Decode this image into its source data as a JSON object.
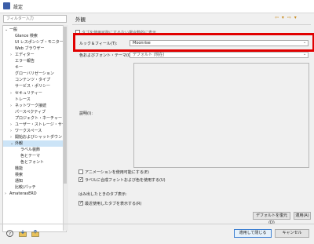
{
  "window": {
    "title": "設定"
  },
  "filter": {
    "placeholder": "フィルター入力"
  },
  "tree": {
    "items": [
      {
        "label": "一般",
        "twisty": "⌄",
        "indent": 0
      },
      {
        "label": "Glance 検索",
        "twisty": "",
        "indent": 1
      },
      {
        "label": "UI レスポンシブ・モニター",
        "twisty": "",
        "indent": 1
      },
      {
        "label": "Web ブラウザー",
        "twisty": "",
        "indent": 1
      },
      {
        "label": "エディター",
        "twisty": "›",
        "indent": 1
      },
      {
        "label": "エラー報告",
        "twisty": "",
        "indent": 1
      },
      {
        "label": "キー",
        "twisty": "",
        "indent": 1
      },
      {
        "label": "グローバリゼーション",
        "twisty": "",
        "indent": 1
      },
      {
        "label": "コンテンツ・タイプ",
        "twisty": "",
        "indent": 1
      },
      {
        "label": "サービス・ポリシー",
        "twisty": "",
        "indent": 1
      },
      {
        "label": "セキュリティー",
        "twisty": "›",
        "indent": 1
      },
      {
        "label": "トレース",
        "twisty": "",
        "indent": 1
      },
      {
        "label": "ネットワーク接続",
        "twisty": "›",
        "indent": 1
      },
      {
        "label": "パースペクティブ",
        "twisty": "",
        "indent": 1
      },
      {
        "label": "プロジェクト・ネーチャー",
        "twisty": "",
        "indent": 1
      },
      {
        "label": "ユーザー・ストレージ・サー",
        "twisty": "›",
        "indent": 1
      },
      {
        "label": "ワークスペース",
        "twisty": "›",
        "indent": 1
      },
      {
        "label": "開始およびシャットダウン",
        "twisty": "›",
        "indent": 1
      },
      {
        "label": "外観",
        "twisty": "⌄",
        "indent": 1,
        "selected": true
      },
      {
        "label": "ラベル装飾",
        "twisty": "",
        "indent": 2
      },
      {
        "label": "色とテーマ",
        "twisty": "",
        "indent": 2
      },
      {
        "label": "色とフォント",
        "twisty": "",
        "indent": 2
      },
      {
        "label": "機能",
        "twisty": "",
        "indent": 1
      },
      {
        "label": "検索",
        "twisty": "",
        "indent": 1
      },
      {
        "label": "通知",
        "twisty": "",
        "indent": 1
      },
      {
        "label": "比較/パッチ",
        "twisty": "",
        "indent": 1
      },
      {
        "label": "AmaterasERD",
        "twisty": "›",
        "indent": 0
      }
    ]
  },
  "page": {
    "title": "外観",
    "nav_arrows": "⇦ ▾ ⇨ ▾",
    "hidden_option_label": "タブを使用可能にするない場合動的に表示",
    "look_feel_label": "ルック＆フィール(T):",
    "look_feel_value": "Moonrise",
    "theme_label": "色およびフォント・テーマ(C):",
    "theme_value": "デフォルト (現在)",
    "description_label": "説明(I):",
    "animation_label": "アニメーションを使用可能にする(E)",
    "mixed_fonts_label": "ラベルに合成フォントおよび色を使用する(U)",
    "tabs_section_label": "はみ出したときのタブ表示:",
    "recent_tabs_label": "最近使用したタブを表示する(R)"
  },
  "buttons": {
    "restore_defaults": "デフォルトを復元(D)",
    "apply": "適用(A)",
    "apply_close": "適用して閉じる",
    "cancel": "キャンセル"
  },
  "colors": {
    "highlight": "#e10000",
    "selection": "#cce4f7",
    "accent": "#3d7fd1"
  }
}
